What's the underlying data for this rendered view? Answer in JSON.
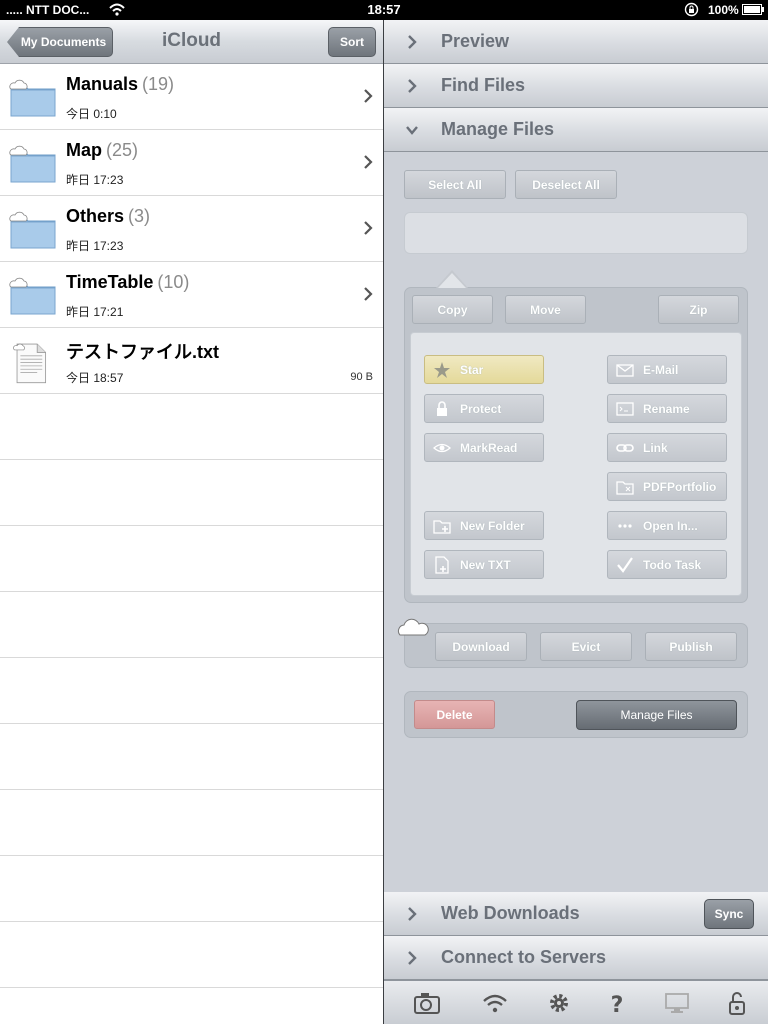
{
  "status": {
    "carrier": "..... NTT DOC...",
    "time": "18:57",
    "battery": "100%"
  },
  "left": {
    "back_label": "My Documents",
    "title": "iCloud",
    "sort_label": "Sort",
    "items": [
      {
        "name": "Manuals",
        "count": "(19)",
        "date": "今日 0:10",
        "size": "",
        "type": "folder"
      },
      {
        "name": "Map",
        "count": "(25)",
        "date": "昨日 17:23",
        "size": "",
        "type": "folder"
      },
      {
        "name": "Others",
        "count": "(3)",
        "date": "昨日 17:23",
        "size": "",
        "type": "folder"
      },
      {
        "name": "TimeTable",
        "count": "(10)",
        "date": "昨日 17:21",
        "size": "",
        "type": "folder"
      },
      {
        "name": "テストファイル.txt",
        "count": "",
        "date": "今日 18:57",
        "size": "90 B",
        "type": "file"
      }
    ]
  },
  "right": {
    "sections": {
      "preview": "Preview",
      "find_files": "Find Files",
      "manage_files": "Manage Files",
      "web_downloads": "Web Downloads",
      "connect_servers": "Connect to Servers"
    },
    "select_all": "Select All",
    "deselect_all": "Deselect All",
    "copy": "Copy",
    "move": "Move",
    "zip": "Zip",
    "actions": {
      "star": "Star",
      "email": "E-Mail",
      "protect": "Protect",
      "rename": "Rename",
      "markread": "MarkRead",
      "link": "Link",
      "pdfportfolio": "PDFPortfolio",
      "new_folder": "New Folder",
      "open_in": "Open In...",
      "new_txt": "New TXT",
      "todo": "Todo Task"
    },
    "download": "Download",
    "evict": "Evict",
    "publish": "Publish",
    "delete": "Delete",
    "manage_files_btn": "Manage Files",
    "sync": "Sync"
  }
}
